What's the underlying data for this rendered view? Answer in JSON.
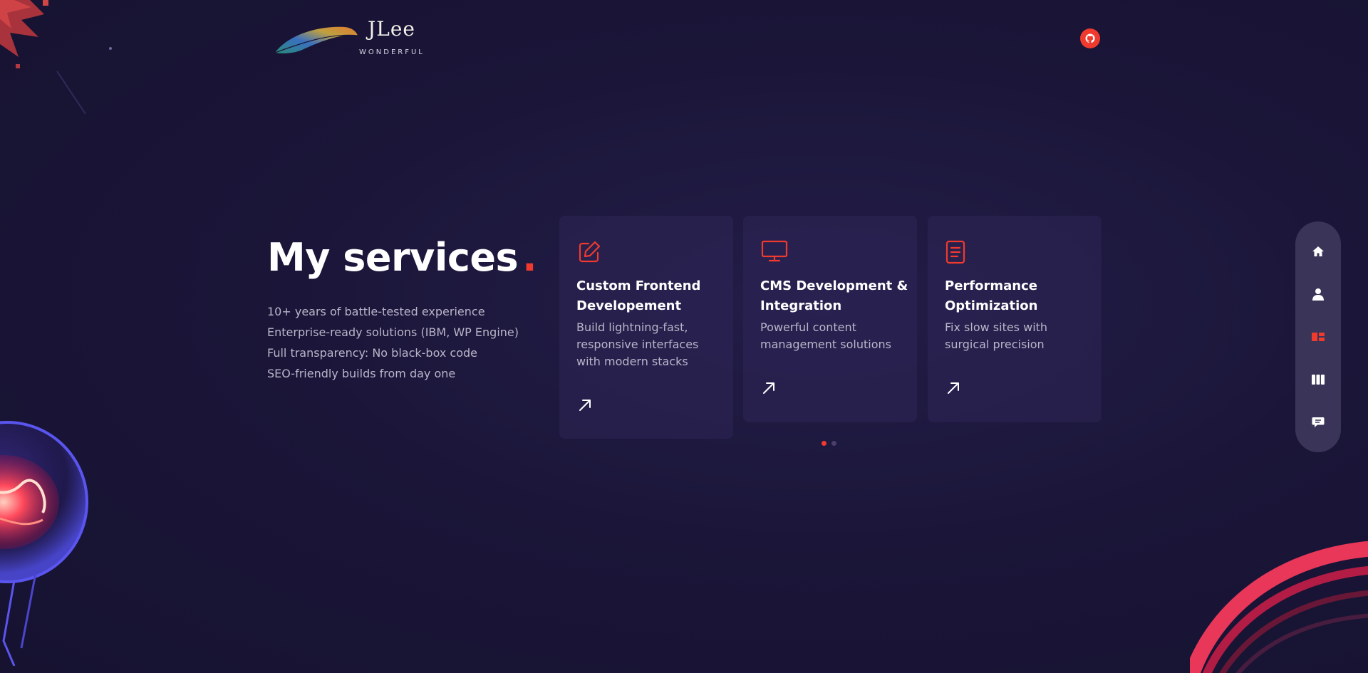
{
  "header": {
    "logo_title": "JLee",
    "logo_subtitle": "WONDERFUL",
    "github_icon": "github-icon"
  },
  "intro": {
    "title": "My services",
    "title_dot": ".",
    "features": [
      "10+ years of battle-tested experience",
      "Enterprise-ready solutions (IBM, WP Engine)",
      "Full transparency: No black-box code",
      "SEO-friendly builds from day one"
    ]
  },
  "services": [
    {
      "icon": "edit-icon",
      "title": "Custom Frontend Developement",
      "description": "Build lightning-fast, responsive interfaces with modern stacks",
      "link_icon": "arrow-up-right-icon"
    },
    {
      "icon": "monitor-icon",
      "title": "CMS Development & Integration",
      "description": "Powerful content management solutions",
      "link_icon": "arrow-up-right-icon"
    },
    {
      "icon": "document-icon",
      "title": "Performance Optimization",
      "description": "Fix slow sites with surgical precision",
      "link_icon": "arrow-up-right-icon"
    }
  ],
  "carousel": {
    "pages": 2,
    "active_page": 1
  },
  "side_nav": [
    {
      "icon": "home-icon",
      "active": false
    },
    {
      "icon": "user-icon",
      "active": false
    },
    {
      "icon": "services-icon",
      "active": true
    },
    {
      "icon": "portfolio-icon",
      "active": false
    },
    {
      "icon": "chat-icon",
      "active": false
    }
  ],
  "colors": {
    "background": "#1a1537",
    "accent": "#f03a2e",
    "card": "#2a2450",
    "text_muted": "#b9b6c9",
    "nav_bg": "#3a3558"
  }
}
